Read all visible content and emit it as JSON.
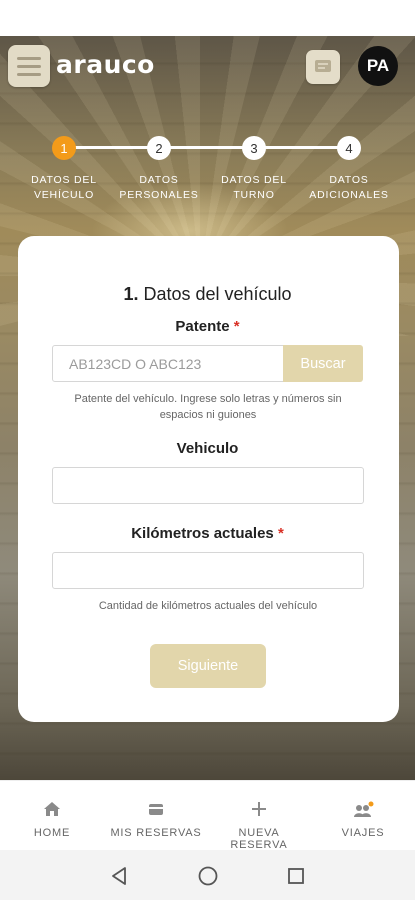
{
  "header": {
    "logo_text": "arauco",
    "avatar_initials": "PA"
  },
  "stepper": {
    "active_step": 1,
    "steps": [
      {
        "number": "1",
        "label_line1": "Datos del",
        "label_line2": "vehículo"
      },
      {
        "number": "2",
        "label_line1": "Datos",
        "label_line2": "personales"
      },
      {
        "number": "3",
        "label_line1": "Datos del",
        "label_line2": "turno"
      },
      {
        "number": "4",
        "label_line1": "Datos",
        "label_line2": "adicionales"
      }
    ]
  },
  "form": {
    "title_number": "1.",
    "title_text": "Datos del vehículo",
    "required_mark": "*",
    "patente": {
      "label": "Patente",
      "placeholder": "AB123CD O ABC123",
      "value": "",
      "button_label": "Buscar",
      "help": "Patente del vehículo. Ingrese solo letras y números sin espacios ni guiones"
    },
    "vehiculo": {
      "label": "Vehiculo",
      "value": ""
    },
    "kilometros": {
      "label": "Kilómetros actuales",
      "value": "",
      "help": "Cantidad de kilómetros actuales del vehículo"
    },
    "next_label": "Siguiente"
  },
  "bottom_nav": {
    "items": [
      {
        "label": "Home",
        "icon": "home-icon"
      },
      {
        "label": "Mis reservas",
        "icon": "wallet-icon"
      },
      {
        "label": "Nueva reserva",
        "icon": "plus-icon"
      },
      {
        "label": "Viajes",
        "icon": "group-icon",
        "badge": true
      }
    ]
  },
  "colors": {
    "accent_orange": "#f39b1a",
    "button_beige": "#e2d6ab",
    "required_red": "#d93025"
  }
}
